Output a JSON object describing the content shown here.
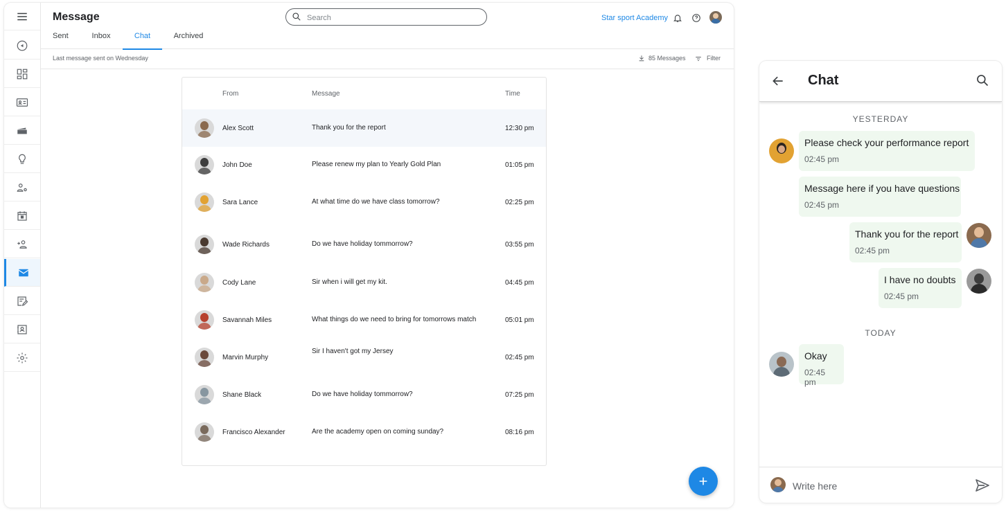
{
  "app": {
    "title": "Message",
    "tabs": [
      {
        "label": "Sent"
      },
      {
        "label": "Inbox"
      },
      {
        "label": "Chat"
      },
      {
        "label": "Archived"
      }
    ],
    "active_tab": "Chat",
    "search": {
      "placeholder": "Search",
      "value": ""
    },
    "org_name": "Star sport Academy",
    "subbar": {
      "last_message": "Last message sent on Wednesday",
      "message_count": "85 Messages",
      "filter_label": "Filter"
    },
    "rail_icons": [
      "menu-icon",
      "compass-icon",
      "dashboard-icon",
      "id-card-icon",
      "cards-icon",
      "lightbulb-icon",
      "user-settings-icon",
      "calendar-icon",
      "add-person-icon",
      "mail-icon",
      "edit-note-icon",
      "contact-book-icon",
      "gear-icon"
    ],
    "active_rail": "mail-icon"
  },
  "table": {
    "headers": {
      "from": "From",
      "message": "Message",
      "time": "Time"
    },
    "rows": [
      {
        "from": "Alex Scott",
        "message": "Thank you for the report",
        "time": "12:30 pm",
        "selected": true,
        "avatar": "#8a6a4e"
      },
      {
        "from": "John Doe",
        "message": "Please renew my plan to Yearly Gold Plan",
        "time": "01:05 pm",
        "avatar": "#3d3d3d"
      },
      {
        "from": "Sara Lance",
        "message": "At what time do we have class tomorrow?",
        "time": "02:25 pm",
        "avatar": "#e2a232"
      },
      {
        "from": "Wade Richards",
        "message": "Do we have holiday tommorrow?",
        "time": "03:55 pm",
        "avatar": "#4a3a30"
      },
      {
        "from": "Cody Lane",
        "message": "Sir when i will get my kit.",
        "time": "04:45 pm",
        "avatar": "#c9a98a"
      },
      {
        "from": "Savannah Miles",
        "message": "What things do we need to bring for tomorrows match",
        "time": "05:01 pm",
        "avatar": "#b7412e"
      },
      {
        "from": "Marvin Murphy",
        "message": "Sir I haven't got my Jersey",
        "time": "02:45 pm",
        "avatar": "#6b4a3c"
      },
      {
        "from": "Shane Black",
        "message": "Do we have holiday tommorrow?",
        "time": "07:25 pm",
        "avatar": "#8796a0"
      },
      {
        "from": "Francisco Alexander",
        "message": "Are the academy open on coming sunday?",
        "time": "08:16 pm",
        "avatar": "#7a6a5c"
      }
    ]
  },
  "chat": {
    "title": "Chat",
    "day_labels": {
      "yesterday": "YESTERDAY",
      "today": "TODAY"
    },
    "messages": [
      {
        "text": "Please check your performance report",
        "time": "02:45 pm",
        "side": "left",
        "avatar": "#e2a232"
      },
      {
        "text": "Message here if you have questions",
        "time": "02:45 pm",
        "side": "left"
      },
      {
        "text": "Thank you for the report",
        "time": "02:45 pm",
        "side": "right",
        "avatar": "#8a6a4e"
      },
      {
        "text": "I have no doubts",
        "time": "02:45 pm",
        "side": "right",
        "avatar": "#3d3d3d"
      },
      {
        "text": "Okay",
        "time": "02:45 pm",
        "side": "left",
        "avatar": "#8796a0"
      }
    ],
    "compose": {
      "placeholder": "Write here",
      "value": ""
    }
  },
  "colors": {
    "accent": "#1e88e5",
    "bubble": "#eff8ef",
    "selected_row": "#f4f7fb"
  }
}
